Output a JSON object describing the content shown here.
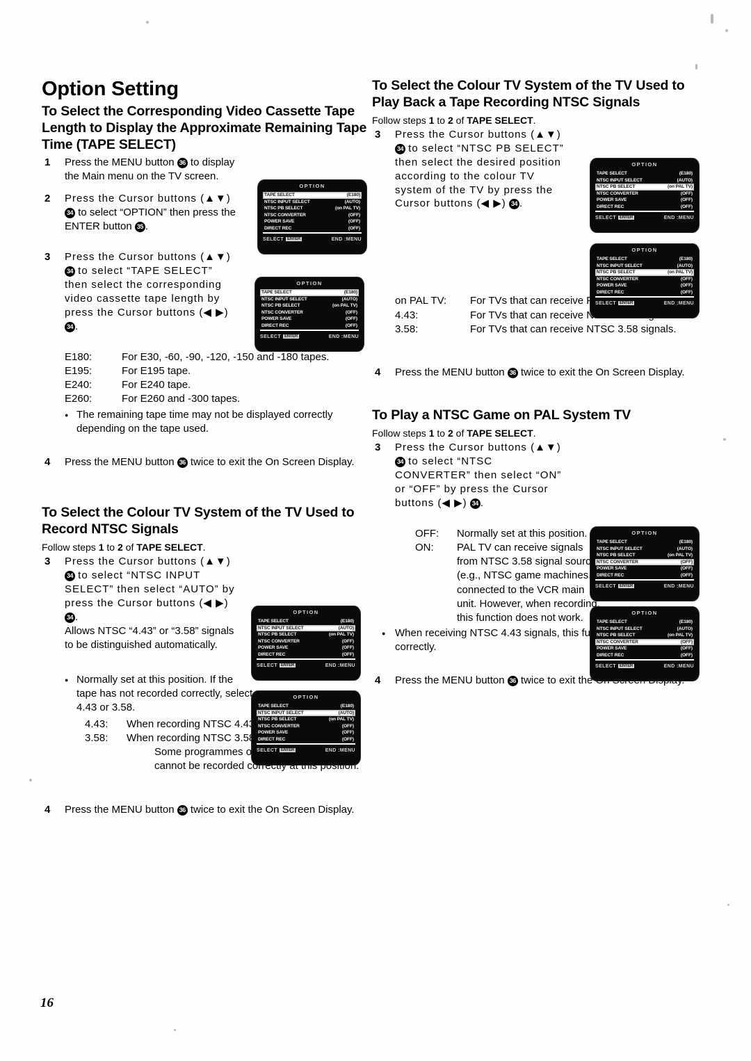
{
  "document": {
    "title": "Option Setting",
    "page_number": "16"
  },
  "osd_menu": {
    "screen_title": "OPTION",
    "rows": [
      {
        "label": "TAPE SELECT",
        "value": "(E180)"
      },
      {
        "label": "NTSC INPUT SELECT",
        "value": "(AUTO)"
      },
      {
        "label": "NTSC PB SELECT",
        "value": "(on PAL TV)"
      },
      {
        "label": "NTSC CONVERTER",
        "value": "(OFF)"
      },
      {
        "label": "POWER SAVE",
        "value": "(OFF)"
      },
      {
        "label": "DIRECT REC",
        "value": "(OFF)"
      }
    ],
    "footer_select": "SELECT",
    "footer_select_key": "ENTER",
    "footer_end": "END :MENU"
  },
  "left_column": {
    "section1": {
      "heading": "To Select the Corresponding Video Cassette Tape Length to Display the Approximate Remaining Tape Time (TAPE SELECT)",
      "step1": {
        "num": "1",
        "text_a": "Press the MENU button",
        "badge": "36",
        "text_b": "to display the Main menu on the TV screen."
      },
      "step2": {
        "num": "2",
        "text_a": "Press the Cursor buttons (▲▼)",
        "badge1": "34",
        "text_b": "to select “OPTION” then press the ENTER button",
        "badge2": "35",
        "text_c": "."
      },
      "step3": {
        "num": "3",
        "text_a": "Press the Cursor buttons (▲▼)",
        "badge1": "34",
        "text_b": "to select “TAPE SELECT” then select the corresponding video cassette tape length by press the Cursor buttons (◀ ▶)",
        "badge2": "34",
        "text_c": "."
      },
      "tape_table": [
        {
          "term": "E180:",
          "desc": "For E30, -60, -90, -120, -150 and -180 tapes."
        },
        {
          "term": "E195:",
          "desc": "For E195 tape."
        },
        {
          "term": "E240:",
          "desc": "For E240 tape."
        },
        {
          "term": "E260:",
          "desc": "For E260 and -300 tapes."
        }
      ],
      "note_bullet": "The remaining tape time may not be displayed correctly depending on the tape used.",
      "step4": {
        "num": "4",
        "text_a": "Press the MENU button",
        "badge": "36",
        "text_b": "twice to exit the On Screen Display."
      }
    },
    "section2": {
      "heading": "To Select the Colour TV System of the TV Used to Record NTSC Signals",
      "follow_a": "Follow steps ",
      "follow_b": "1",
      "follow_c": " to ",
      "follow_d": "2",
      "follow_e": " of ",
      "follow_f": "TAPE SELECT",
      "follow_g": ".",
      "step3": {
        "num": "3",
        "text_a": "Press the Cursor buttons (▲▼)",
        "badge1": "34",
        "text_b": "to select “NTSC INPUT SELECT” then select “AUTO” by press the Cursor buttons (◀ ▶)",
        "badge2": "34",
        "text_c": ".",
        "text_d": "Allows NTSC “4.43” or “3.58” signals to be distinguished automatically."
      },
      "note_bullet": "Normally set  at this position. If the tape has not recorded correctly, select 4.43 or 3.58.",
      "rec_table": [
        {
          "term": "4.43:",
          "desc": "When recording NTSC 4.43 signals."
        },
        {
          "term": "3.58:",
          "desc": "When recording NTSC 3.58 signals"
        }
      ],
      "rec_extra": "Some programmes on NTSC 3.58 system cannot be recorded correctly at this position.",
      "step4": {
        "num": "4",
        "text_a": "Press the MENU button",
        "badge": "36",
        "text_b": "twice to exit the On Screen Display."
      }
    }
  },
  "right_column": {
    "section3": {
      "heading": "To Select the Colour TV System of the TV Used to Play Back a Tape Recording NTSC Signals",
      "follow_a": "Follow steps ",
      "follow_b": "1",
      "follow_c": " to ",
      "follow_d": "2",
      "follow_e": " of ",
      "follow_f": "TAPE SELECT",
      "follow_g": ".",
      "step3": {
        "num": "3",
        "text_a": "Press the Cursor buttons (▲▼)",
        "badge1": "34",
        "text_b": "to select “NTSC PB SELECT” then select the desired position according to the colour TV system of the TV by press the Cursor buttons (◀ ▶)",
        "badge2": "34",
        "text_c": "."
      },
      "pb_table": [
        {
          "term": "on PAL TV:",
          "desc": "For TVs that can receive PAL signals."
        },
        {
          "term": "4.43:",
          "desc": "For TVs that can receive NTSC 4.43 signals."
        },
        {
          "term": "3.58:",
          "desc": "For TVs that can receive NTSC 3.58 signals."
        }
      ],
      "step4": {
        "num": "4",
        "text_a": "Press the MENU button",
        "badge": "36",
        "text_b": "twice to exit the On Screen Display."
      }
    },
    "section4": {
      "heading": "To Play a NTSC Game on PAL System TV",
      "follow_a": "Follow steps ",
      "follow_b": "1",
      "follow_c": " to ",
      "follow_d": "2",
      "follow_e": " of ",
      "follow_f": "TAPE SELECT",
      "follow_g": ".",
      "step3": {
        "num": "3",
        "text_a": "Press the Cursor buttons (▲▼)",
        "badge1": "34",
        "text_b": "to select “NTSC CONVERTER” then select “ON” or “OFF” by press the Cursor buttons (◀ ▶)",
        "badge2": "34",
        "text_c": "."
      },
      "onoff_table": [
        {
          "term": "OFF:",
          "desc": "Normally set at this position."
        },
        {
          "term": "ON:",
          "desc": "PAL TV can receive signals from NTSC 3.58 signal source (e.g., NTSC game machines.) connected to the VCR main unit. However, when recording, this function does not work."
        }
      ],
      "note_bullet": "When receiving NTSC 4.43 signals, this function does not work correctly.",
      "step4": {
        "num": "4",
        "text_a": "Press the MENU button",
        "badge": "36",
        "text_b": "twice to exit the On Screen Display."
      }
    }
  }
}
